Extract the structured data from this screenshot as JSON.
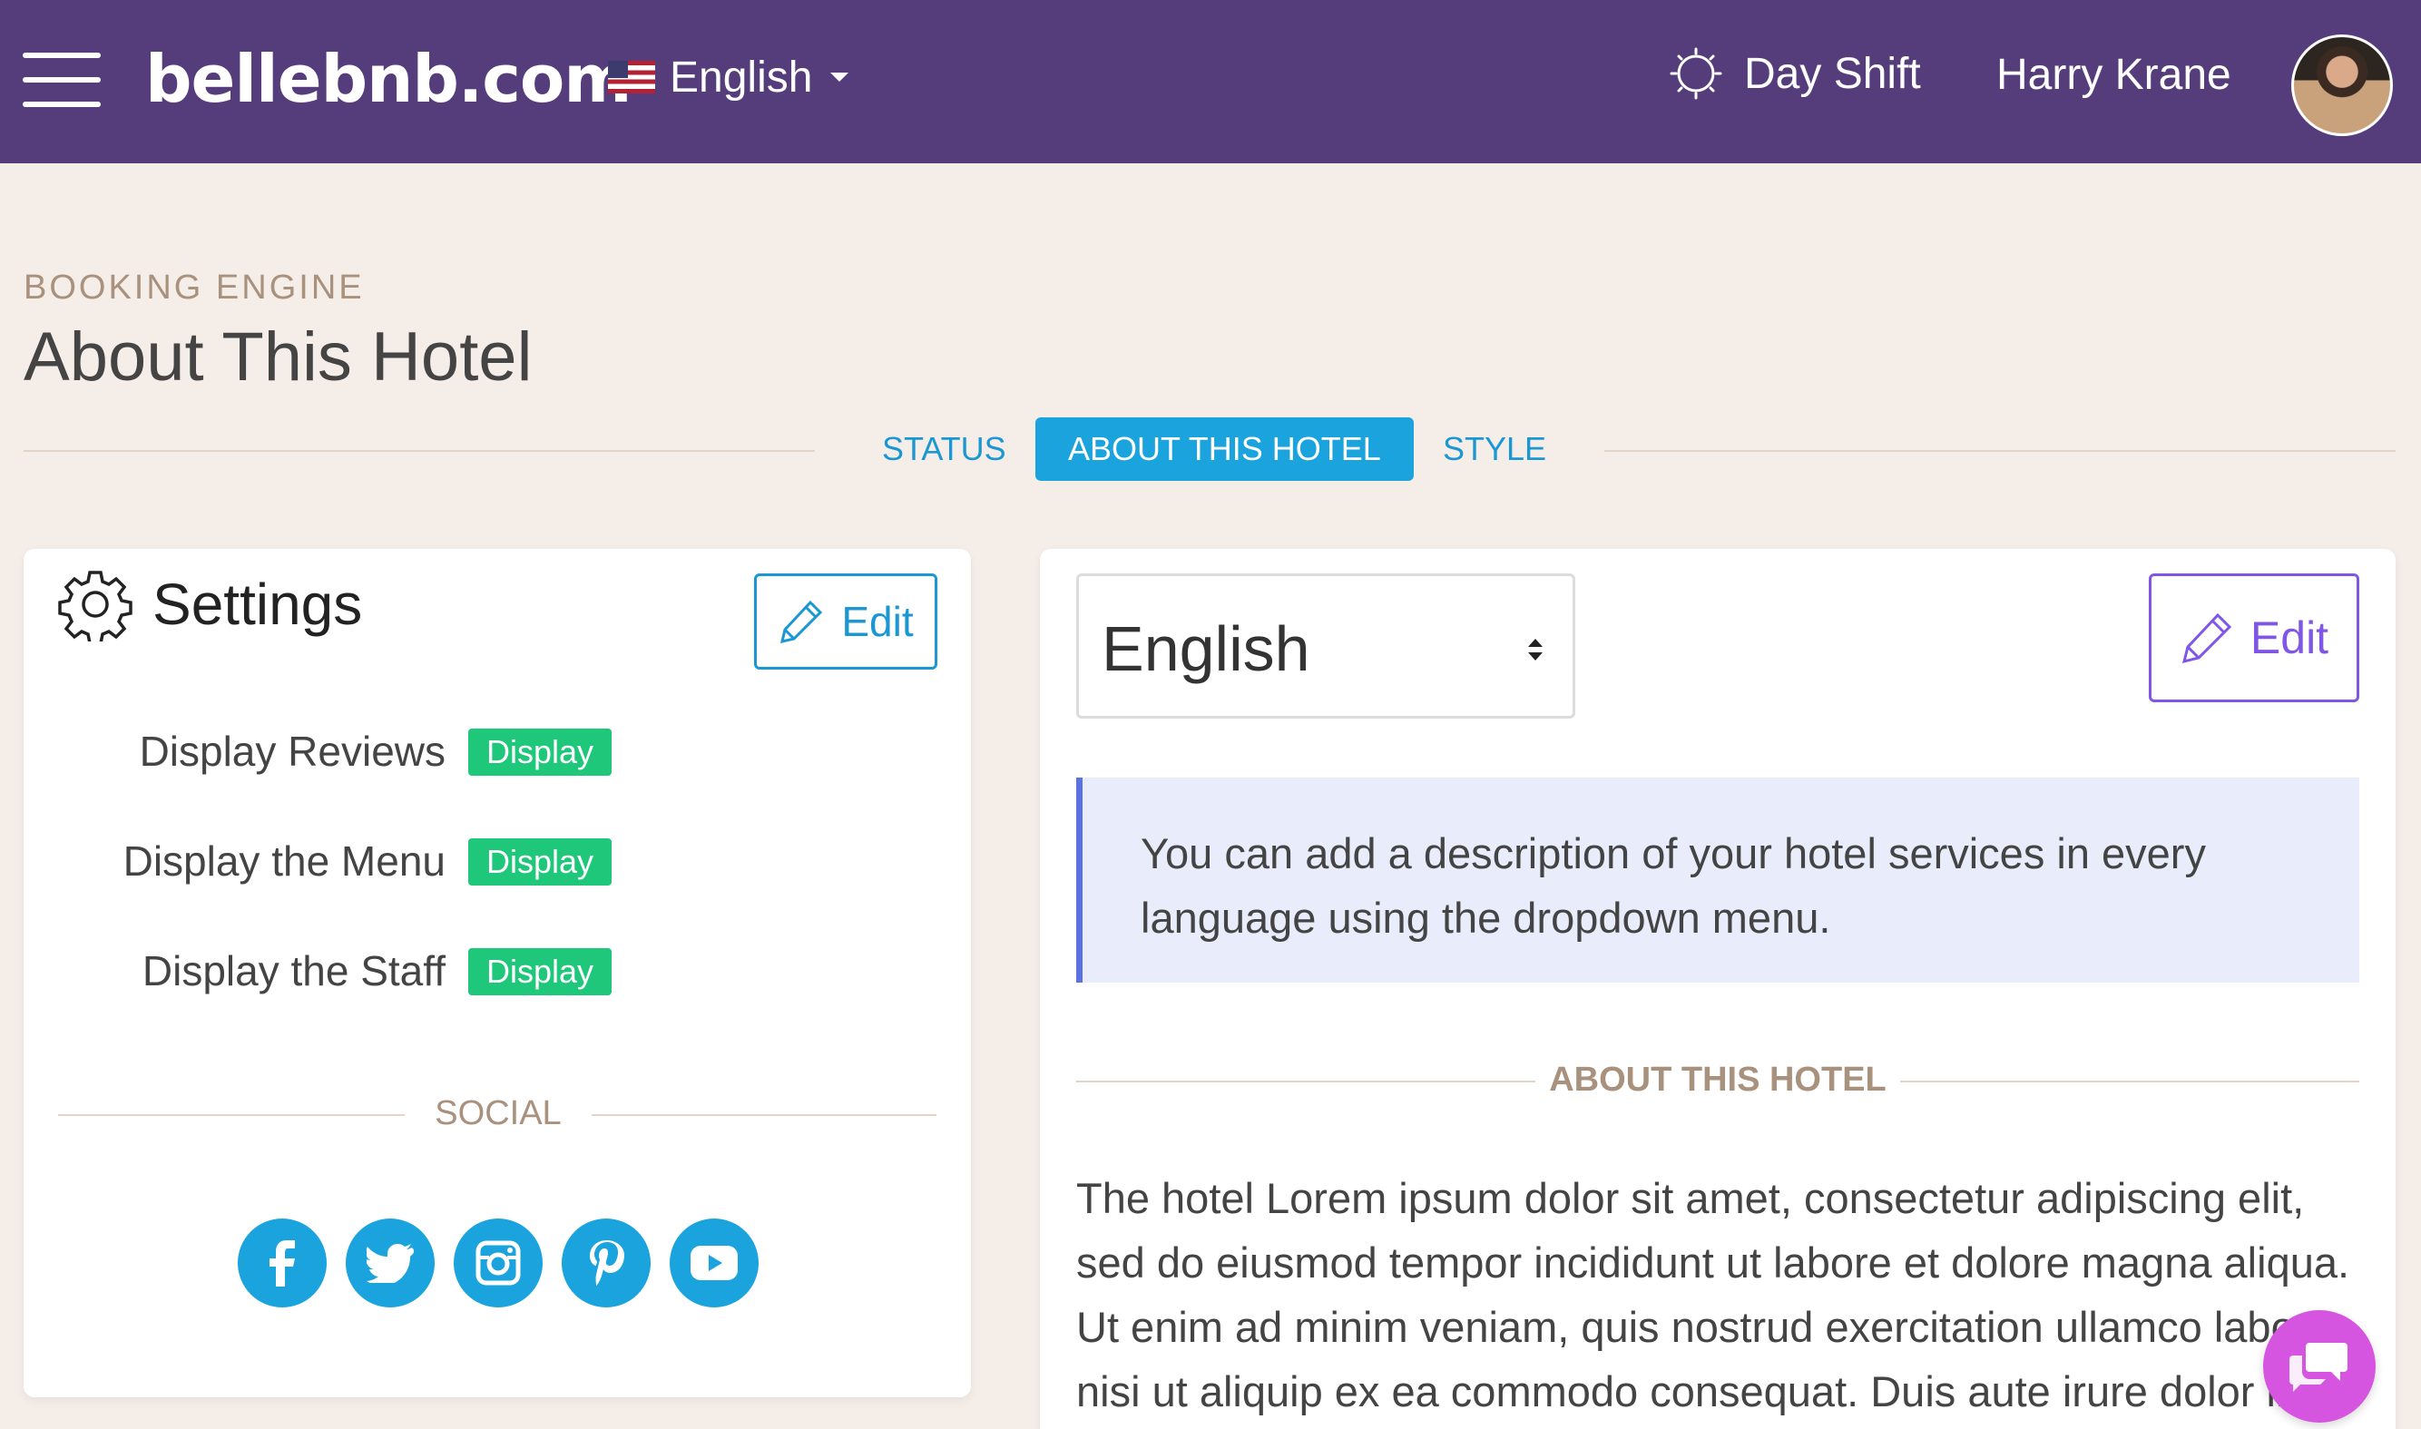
{
  "header": {
    "brand": "bellebnb.com",
    "language": "English",
    "shift": "Day Shift",
    "user_name": "Harry Krane"
  },
  "page": {
    "breadcrumb": "BOOKING ENGINE",
    "title": "About This Hotel",
    "tabs": [
      {
        "label": "STATUS",
        "active": false
      },
      {
        "label": "ABOUT THIS HOTEL",
        "active": true
      },
      {
        "label": "STYLE",
        "active": false
      }
    ]
  },
  "settings": {
    "title": "Settings",
    "edit_label": "Edit",
    "rows": [
      {
        "label": "Display Reviews",
        "badge": "Display"
      },
      {
        "label": "Display the Menu",
        "badge": "Display"
      },
      {
        "label": "Display the Staff",
        "badge": "Display"
      }
    ],
    "social_title": "SOCIAL",
    "social_icons": [
      "facebook-icon",
      "twitter-icon",
      "instagram-icon",
      "pinterest-icon",
      "youtube-icon"
    ]
  },
  "about": {
    "language_select": "English",
    "edit_label": "Edit",
    "info_text": "You can add a description of your hotel services in every language using the dropdown menu.",
    "section_title": "ABOUT THIS HOTEL",
    "body_text": "The hotel Lorem ipsum dolor sit amet, consectetur adipiscing elit, sed do eiusmod tempor incididunt ut labore et dolore magna aliqua. Ut enim ad minim veniam, quis nostrud exercitation ullamco laboris nisi ut aliquip ex ea commodo consequat. Duis aute irure dolor in"
  },
  "colors": {
    "header_bg": "#553d7b",
    "accent_blue": "#1aa3dd",
    "display_green": "#1ec779",
    "edit_purple": "#7f56e6",
    "chat_pink": "#d655e0",
    "page_bg": "#f5ede8"
  }
}
